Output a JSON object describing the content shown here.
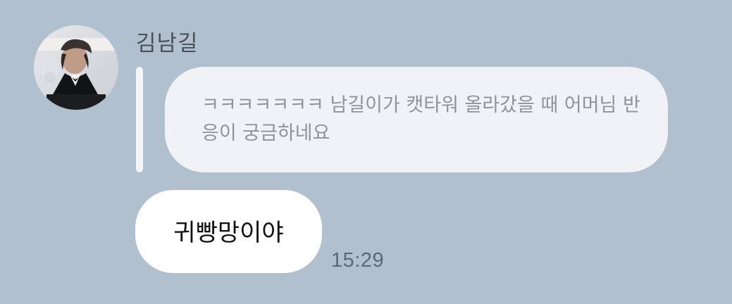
{
  "chat": {
    "sender_name": "김남길",
    "reply": {
      "quoted_text": "ㅋㅋㅋㅋㅋㅋㅋ 남길이가 캣타워 올라갔을 때 어머님 반응이 궁금하네요"
    },
    "message": {
      "text": "귀빵망이야",
      "time": "15:29"
    },
    "colors": {
      "background": "#b1c0cf",
      "quote_bubble": "#f1f2f5",
      "message_bubble": "#ffffff",
      "reply_bar": "#f4f5f7"
    },
    "avatar_icon": "profile-photo"
  }
}
